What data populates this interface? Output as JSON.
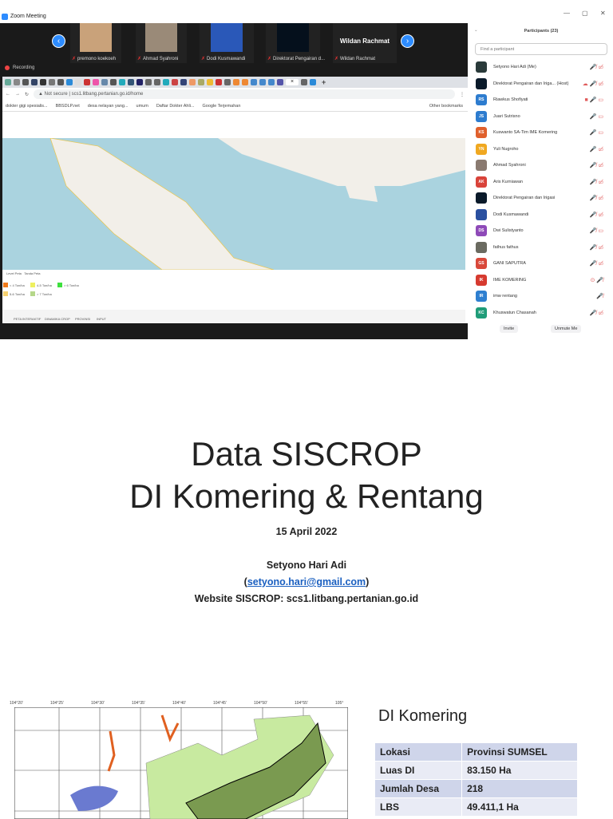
{
  "window": {
    "title": "Zoom Meeting",
    "controls": [
      "—",
      "▢",
      "✕"
    ]
  },
  "video_strip": {
    "tiles": [
      {
        "name": "premono koekoeh"
      },
      {
        "name": "Ahmad Syahroni"
      },
      {
        "name": "Dodi Kusmawandi"
      },
      {
        "name": "Direktorat Pengairan d..."
      },
      {
        "name": "Wildan Rachmat",
        "display": "Wildan Rachmat"
      }
    ]
  },
  "recording": "Recording",
  "browser": {
    "url": "scs1.litbang.pertanian.go.id/home",
    "security": "Not secure",
    "bookmarks": [
      "dokter gigi spesialis...",
      "BBSDLP.net",
      "desa nelayan yang...",
      "umum",
      "Daftar Dokter Ahli...",
      "Google Terjemahan"
    ],
    "other_bookmarks": "Other bookmarks",
    "page": {
      "legend": [
        {
          "label": "< 4 Ton/ha",
          "color": "#f07a1a"
        },
        {
          "label": "4-5 Ton/ha",
          "color": "#eef060"
        },
        {
          "label": "> 6 Ton/ha",
          "color": "#3ee03e"
        },
        {
          "label": "5-6 Ton/ha",
          "color": "#f5d070"
        },
        {
          "label": "> 7 Ton/ha",
          "color": "#b5d78a"
        }
      ],
      "nav": [
        "PETA INTERAKTIF",
        "DINAMIKA CROP",
        "PROVINSI",
        "INPUT"
      ],
      "map_tabs": [
        "Level Peta",
        "Tanda Peta"
      ]
    }
  },
  "participants": {
    "title": "Participants (23)",
    "search_placeholder": "Find a participant",
    "list": [
      {
        "name": "Setyono Hari Adi  (Me)",
        "initials": "",
        "color": "#2a3a3a",
        "icons": "🎤̸ ▭̸"
      },
      {
        "name": "Direktorat Pengairan dan Iriga... (Host)",
        "initials": "",
        "color": "#0a1a2a",
        "icons": "☁ 🎤̸ ▭̸"
      },
      {
        "name": "Riawkus Shofiyati",
        "initials": "RS",
        "color": "#2d7ccf",
        "icons": "■ 🎤 ▭"
      },
      {
        "name": "Juari Sutrisno",
        "initials": "JS",
        "color": "#2d7ccf",
        "icons": "🎤 ▭"
      },
      {
        "name": "Kuswanto SA-Tim IME Komering",
        "initials": "KS",
        "color": "#e0602c",
        "icons": "🎤 ▭"
      },
      {
        "name": "Yuli Nugroho",
        "initials": "YN",
        "color": "#f0a820",
        "icons": "🎤 ▭̸"
      },
      {
        "name": "Ahmad Syahroni",
        "initials": "",
        "color": "#8a7a70",
        "icons": "🎤̸ ▭̸"
      },
      {
        "name": "Aris Kurniawan",
        "initials": "AK",
        "color": "#d9433a",
        "icons": "🎤̸ ▭̸"
      },
      {
        "name": "Direktorat Pengairan dan Irigasi",
        "initials": "",
        "color": "#0a1a2a",
        "icons": "🎤̸ ▭̸"
      },
      {
        "name": "Dodi Kusmawandi",
        "initials": "",
        "color": "#2a50a0",
        "icons": "🎤̸ ▭̸"
      },
      {
        "name": "Dwi Sulistyanto",
        "initials": "DS",
        "color": "#8e4ab8",
        "icons": "🎤̸ ▭"
      },
      {
        "name": "fathus fathus",
        "initials": "",
        "color": "#6a6a60",
        "icons": "🎤̸ ▭̸"
      },
      {
        "name": "GANI SAPUTRA",
        "initials": "GS",
        "color": "#d9483a",
        "icons": "🎤̸ ▭̸"
      },
      {
        "name": "IME KOMERING",
        "initials": "IK",
        "color": "#d63a2f",
        "icons": "⊙ 🎤̸"
      },
      {
        "name": "imw rentang",
        "initials": "IR",
        "color": "#2e7fd0",
        "icons": "🎤̸"
      },
      {
        "name": "Khuswatun Chasanah",
        "initials": "KC",
        "color": "#1f9c78",
        "icons": "🎤̸ ▭̸"
      }
    ],
    "invite": "Invite",
    "unmute": "Unmute Me"
  },
  "slide": {
    "title1": "Data SISCROP",
    "title2": "DI Komering & Rentang",
    "date": "15 April 2022",
    "author": "Setyono Hari Adi",
    "email": "setyono.hari@gmail.com",
    "website": "Website SISCROP: scs1.litbang.pertanian.go.id",
    "map_ticks": [
      "104°20'",
      "104°25'",
      "104°30'",
      "104°35'",
      "104°40'",
      "104°45'",
      "104°50'",
      "104°55'",
      "105°"
    ],
    "section": "DI Komering",
    "table": [
      [
        "Lokasi",
        "Provinsi SUMSEL"
      ],
      [
        "Luas DI",
        "83.150 Ha"
      ],
      [
        "Jumlah Desa",
        "218"
      ],
      [
        "LBS",
        "49.411,1 Ha"
      ]
    ]
  }
}
